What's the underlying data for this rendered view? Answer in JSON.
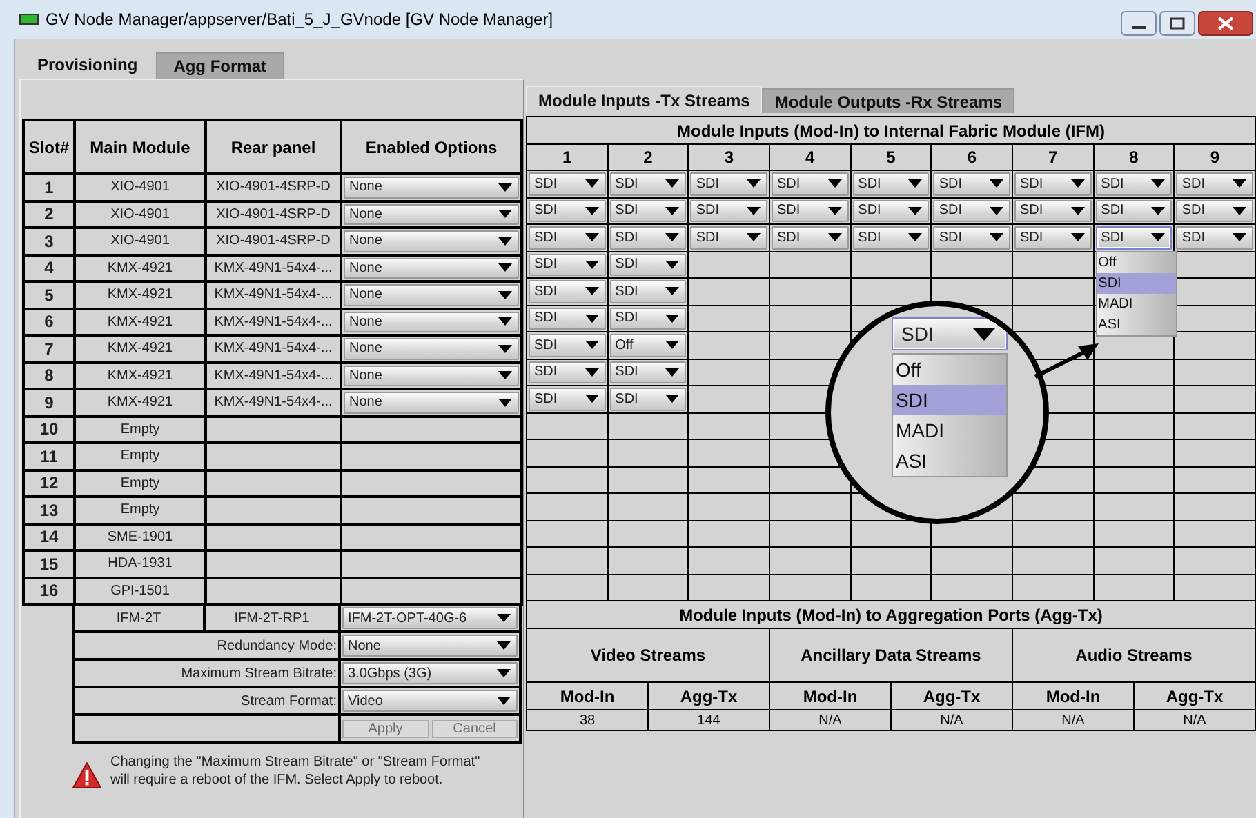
{
  "window": {
    "title": "GV Node Manager/appserver/Bati_5_J_GVnode [GV Node Manager]"
  },
  "tabs": [
    {
      "label": "Provisioning",
      "selected": true
    },
    {
      "label": "Agg Format",
      "selected": false
    }
  ],
  "slots_table": {
    "columns": [
      "Slot#",
      "Main Module",
      "Rear panel",
      "Enabled Options"
    ],
    "rows": [
      {
        "slot": "1",
        "main_module": "XIO-4901",
        "rear_panel": "XIO-4901-4SRP-D",
        "enabled_options": "None"
      },
      {
        "slot": "2",
        "main_module": "XIO-4901",
        "rear_panel": "XIO-4901-4SRP-D",
        "enabled_options": "None"
      },
      {
        "slot": "3",
        "main_module": "XIO-4901",
        "rear_panel": "XIO-4901-4SRP-D",
        "enabled_options": "None"
      },
      {
        "slot": "4",
        "main_module": "KMX-4921",
        "rear_panel": "KMX-49N1-54x4-...",
        "enabled_options": "None"
      },
      {
        "slot": "5",
        "main_module": "KMX-4921",
        "rear_panel": "KMX-49N1-54x4-...",
        "enabled_options": "None"
      },
      {
        "slot": "6",
        "main_module": "KMX-4921",
        "rear_panel": "KMX-49N1-54x4-...",
        "enabled_options": "None"
      },
      {
        "slot": "7",
        "main_module": "KMX-4921",
        "rear_panel": "KMX-49N1-54x4-...",
        "enabled_options": "None"
      },
      {
        "slot": "8",
        "main_module": "KMX-4921",
        "rear_panel": "KMX-49N1-54x4-...",
        "enabled_options": "None"
      },
      {
        "slot": "9",
        "main_module": "KMX-4921",
        "rear_panel": "KMX-49N1-54x4-...",
        "enabled_options": "None"
      },
      {
        "slot": "10",
        "main_module": "Empty"
      },
      {
        "slot": "11",
        "main_module": "Empty"
      },
      {
        "slot": "12",
        "main_module": "Empty"
      },
      {
        "slot": "13",
        "main_module": "Empty"
      },
      {
        "slot": "14",
        "main_module": "SME-1901"
      },
      {
        "slot": "15",
        "main_module": "HDA-1931"
      },
      {
        "slot": "16",
        "main_module": "GPI-1501"
      }
    ]
  },
  "ifm": {
    "main_module": "IFM-2T",
    "rear_panel": "IFM-2T-RP1",
    "enabled_options": "IFM-2T-OPT-40G-6",
    "settings": [
      {
        "label": "Redundancy Mode:",
        "value": "None"
      },
      {
        "label": "Maximum Stream Bitrate:",
        "value": "3.0Gbps (3G)"
      },
      {
        "label": "Stream Format:",
        "value": "Video"
      }
    ],
    "buttons": [
      {
        "label": "Apply",
        "disabled": true
      },
      {
        "label": "Cancel",
        "disabled": true
      }
    ]
  },
  "warning": "Changing the \"Maximum Stream Bitrate\" or \"Stream Format\" will require a reboot of the IFM. Select Apply to reboot.",
  "stream_tabs": [
    {
      "label": "Module Inputs -Tx Streams",
      "selected": true
    },
    {
      "label": "Module Outputs -Rx Streams",
      "selected": false
    }
  ],
  "ifm_grid": {
    "title": "Module Inputs (Mod-In) to Internal Fabric Module (IFM)",
    "columns": [
      "1",
      "2",
      "3",
      "4",
      "5",
      "6",
      "7",
      "8",
      "9"
    ],
    "rows": [
      {
        "cells": [
          {
            "value": "SDI",
            "open": false
          },
          {
            "value": "SDI",
            "open": false
          },
          {
            "value": "SDI",
            "open": false
          },
          {
            "value": "SDI",
            "open": false
          },
          {
            "value": "SDI",
            "open": false
          },
          {
            "value": "SDI",
            "open": false
          },
          {
            "value": "SDI",
            "open": false
          },
          {
            "value": "SDI",
            "open": false
          },
          {
            "value": "SDI",
            "open": false
          }
        ]
      },
      {
        "cells": [
          {
            "value": "SDI",
            "open": false
          },
          {
            "value": "SDI",
            "open": false
          },
          {
            "value": "SDI",
            "open": false
          },
          {
            "value": "SDI",
            "open": false
          },
          {
            "value": "SDI",
            "open": false
          },
          {
            "value": "SDI",
            "open": false
          },
          {
            "value": "SDI",
            "open": false
          },
          {
            "value": "SDI",
            "open": false
          },
          {
            "value": "SDI",
            "open": false
          }
        ]
      },
      {
        "cells": [
          {
            "value": "SDI",
            "open": false
          },
          {
            "value": "SDI",
            "open": false
          },
          {
            "value": "SDI",
            "open": false
          },
          {
            "value": "SDI",
            "open": false
          },
          {
            "value": "SDI",
            "open": false
          },
          {
            "value": "SDI",
            "open": false
          },
          {
            "value": "SDI",
            "open": false
          },
          {
            "value": "SDI",
            "open": true,
            "options": [
              {
                "label": "Off",
                "selected": false
              },
              {
                "label": "SDI",
                "selected": true
              },
              {
                "label": "MADI",
                "selected": false
              },
              {
                "label": "ASI",
                "selected": false
              }
            ]
          },
          {
            "value": "SDI",
            "open": false
          }
        ]
      },
      {
        "cells": [
          {
            "value": "SDI",
            "open": false
          },
          {
            "value": "SDI",
            "open": false
          }
        ]
      },
      {
        "cells": [
          {
            "value": "SDI",
            "open": false
          },
          {
            "value": "SDI",
            "open": false
          }
        ]
      },
      {
        "cells": [
          {
            "value": "SDI",
            "open": false
          },
          {
            "value": "SDI",
            "open": false
          }
        ]
      },
      {
        "cells": [
          {
            "value": "SDI",
            "open": false
          },
          {
            "value": "Off",
            "open": false
          }
        ]
      },
      {
        "cells": [
          {
            "value": "SDI",
            "open": false
          },
          {
            "value": "SDI",
            "open": false
          }
        ]
      },
      {
        "cells": [
          {
            "value": "SDI",
            "open": false
          },
          {
            "value": "SDI",
            "open": false
          }
        ]
      }
    ]
  },
  "magnifier": {
    "value": "SDI",
    "options": [
      {
        "label": "Off",
        "selected": false
      },
      {
        "label": "SDI",
        "selected": true
      },
      {
        "label": "MADI",
        "selected": false
      },
      {
        "label": "ASI",
        "selected": false
      }
    ]
  },
  "agg_table": {
    "title": "Module Inputs (Mod-In) to Aggregation Ports (Agg-Tx)",
    "groups": [
      {
        "name": "Video Streams",
        "columns": [
          "Mod-In",
          "Agg-Tx"
        ],
        "values": [
          "38",
          "144"
        ]
      },
      {
        "name": "Ancillary Data Streams",
        "columns": [
          "Mod-In",
          "Agg-Tx"
        ],
        "values": [
          "N/A",
          "N/A"
        ]
      },
      {
        "name": "Audio Streams",
        "columns": [
          "Mod-In",
          "Agg-Tx"
        ],
        "values": [
          "N/A",
          "N/A"
        ]
      }
    ]
  }
}
